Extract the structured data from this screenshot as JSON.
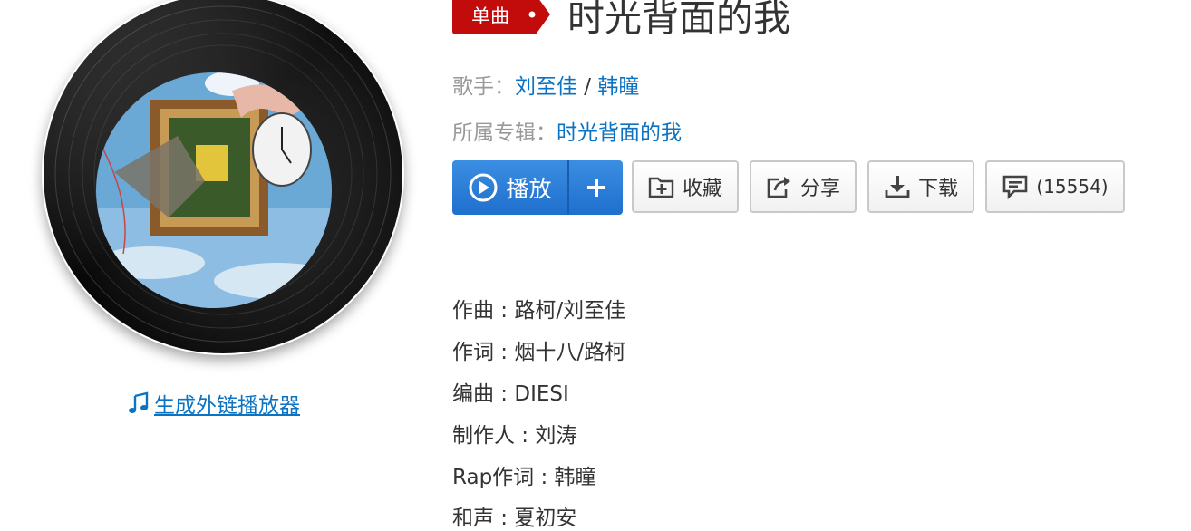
{
  "song": {
    "badge": "单曲",
    "title": "时光背面的我",
    "singer_label": "歌手：",
    "singers": [
      "刘至佳",
      "韩瞳"
    ],
    "singer_sep": " / ",
    "album_label": "所属专辑：",
    "album": "时光背面的我"
  },
  "actions": {
    "play": "播放",
    "add_icon": "plus-icon",
    "collect": "收藏",
    "share": "分享",
    "download": "下载",
    "comment": "(15554)"
  },
  "credits": [
    "作曲 : 路柯/刘至佳",
    "作词 : 烟十八/路柯",
    "编曲 : DIESI",
    "制作人 : 刘涛",
    "Rap作词 : 韩瞳",
    "和声 : 夏初安"
  ],
  "outchain": {
    "label": "生成外链播放器",
    "icon": "music-note-icon"
  },
  "colors": {
    "link": "#0c73c2",
    "badge": "#c20c0c",
    "play": "#2272cf",
    "muted": "#999999"
  }
}
